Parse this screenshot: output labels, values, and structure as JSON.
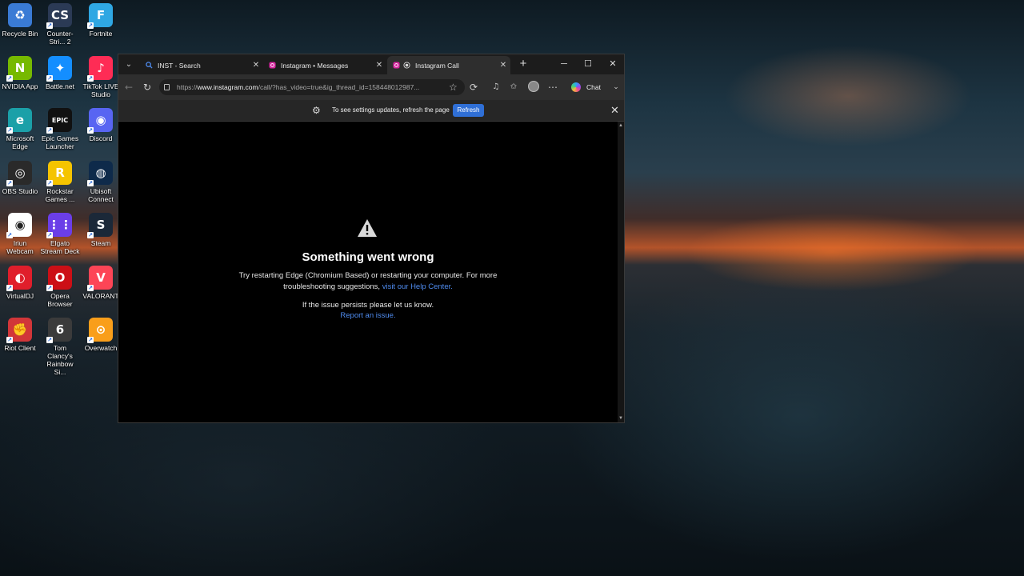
{
  "desktop": {
    "icons": [
      {
        "label": "Recycle Bin",
        "glyph": "♻",
        "color": "#3a7bd5",
        "icon": "recycle-bin-icon"
      },
      {
        "label": "Counter-Stri... 2",
        "glyph": "CS",
        "color": "#2b3a55",
        "icon": "counter-strike-icon"
      },
      {
        "label": "Fortnite",
        "glyph": "F",
        "color": "#2fa7e3",
        "icon": "fortnite-icon"
      },
      {
        "label": "NVIDIA App",
        "glyph": "N",
        "color": "#76b900",
        "icon": "nvidia-icon"
      },
      {
        "label": "Battle.net",
        "glyph": "✦",
        "color": "#148eff",
        "icon": "battlenet-icon"
      },
      {
        "label": "TikTok LIVE Studio",
        "glyph": "♪",
        "color": "#fe2c55",
        "icon": "tiktok-icon"
      },
      {
        "label": "Microsoft Edge",
        "glyph": "e",
        "color": "#1ba0a8",
        "icon": "edge-icon"
      },
      {
        "label": "Epic Games Launcher",
        "glyph": "EPIC",
        "color": "#111111",
        "icon": "epic-games-icon"
      },
      {
        "label": "Discord",
        "glyph": "◉",
        "color": "#5865f2",
        "icon": "discord-icon"
      },
      {
        "label": "OBS Studio",
        "glyph": "◎",
        "color": "#2a2a2a",
        "icon": "obs-icon"
      },
      {
        "label": "Rockstar Games ...",
        "glyph": "R",
        "color": "#f5c400",
        "icon": "rockstar-icon"
      },
      {
        "label": "Ubisoft Connect",
        "glyph": "◍",
        "color": "#0e2a4a",
        "icon": "ubisoft-icon"
      },
      {
        "label": "Iriun Webcam",
        "glyph": "◉",
        "color": "#ffffff",
        "icon": "iriun-webcam-icon"
      },
      {
        "label": "Elgato Stream Deck",
        "glyph": "⋮⋮",
        "color": "#6b3ee8",
        "icon": "stream-deck-icon"
      },
      {
        "label": "Steam",
        "glyph": "S",
        "color": "#1b2838",
        "icon": "steam-icon"
      },
      {
        "label": "VirtualDJ",
        "glyph": "◐",
        "color": "#e01e2b",
        "icon": "virtualdj-icon"
      },
      {
        "label": "Opera Browser",
        "glyph": "O",
        "color": "#cc0f16",
        "icon": "opera-icon"
      },
      {
        "label": "VALORANT",
        "glyph": "V",
        "color": "#fd4556",
        "icon": "valorant-icon"
      },
      {
        "label": "Riot Client",
        "glyph": "✊",
        "color": "#d13639",
        "icon": "riot-client-icon"
      },
      {
        "label": "Tom Clancy's Rainbow Si...",
        "glyph": "6",
        "color": "#3b3b3b",
        "icon": "rainbow-six-icon"
      },
      {
        "label": "Overwatch",
        "glyph": "⊙",
        "color": "#f99e1a",
        "icon": "overwatch-icon"
      }
    ]
  },
  "browser": {
    "tabs": [
      {
        "title": "INST - Search",
        "icon": "search-icon",
        "active": false
      },
      {
        "title": "Instagram • Messages",
        "icon": "instagram-icon",
        "active": false
      },
      {
        "title": "Instagram Call",
        "icon": "instagram-icon",
        "active": true
      }
    ],
    "new_tab": "+",
    "window_controls": {
      "minimize": "─",
      "maximize": "☐",
      "close": "✕"
    },
    "url_prefix": "https://",
    "url_host": "www.instagram.com",
    "url_path": "/call/?has_video=true&ig_thread_id=158448012987...",
    "copilot_label": "Chat",
    "infobar": {
      "message": "To see settings updates, refresh the page",
      "button": "Refresh"
    },
    "error": {
      "title": "Something went wrong",
      "body": "Try restarting Edge (Chromium Based) or restarting your computer. For more troubleshooting suggestions,",
      "help_link": "visit our Help Center.",
      "persist": "If the issue persists please let us know.",
      "report_link": "Report an issue."
    }
  }
}
